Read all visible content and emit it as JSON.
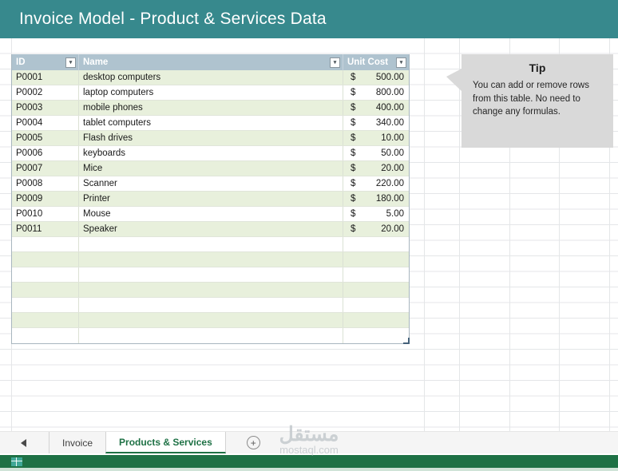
{
  "header": {
    "title": "Invoice Model - Product & Services Data"
  },
  "table": {
    "headers": [
      "ID",
      "Name",
      "Unit Cost"
    ],
    "rows": [
      {
        "id": "P0001",
        "name": "desktop computers",
        "cur": "$",
        "cost": "500.00"
      },
      {
        "id": "P0002",
        "name": "laptop computers",
        "cur": "$",
        "cost": "800.00"
      },
      {
        "id": "P0003",
        "name": "mobile phones",
        "cur": "$",
        "cost": "400.00"
      },
      {
        "id": "P0004",
        "name": "tablet computers",
        "cur": "$",
        "cost": "340.00"
      },
      {
        "id": "P0005",
        "name": "Flash drives",
        "cur": "$",
        "cost": "10.00"
      },
      {
        "id": "P0006",
        "name": "keyboards",
        "cur": "$",
        "cost": "50.00"
      },
      {
        "id": "P0007",
        "name": "Mice",
        "cur": "$",
        "cost": "20.00"
      },
      {
        "id": "P0008",
        "name": "Scanner",
        "cur": "$",
        "cost": "220.00"
      },
      {
        "id": "P0009",
        "name": "Printer",
        "cur": "$",
        "cost": "180.00"
      },
      {
        "id": "P0010",
        "name": "Mouse",
        "cur": "$",
        "cost": "5.00"
      },
      {
        "id": "P0011",
        "name": "Speaker",
        "cur": "$",
        "cost": "20.00"
      }
    ],
    "empty_rows": 7
  },
  "tip": {
    "title": "Tip",
    "body": "You can add or remove rows from this table. No need to change any formulas."
  },
  "tabs": {
    "items": [
      {
        "label": "Invoice",
        "active": false
      },
      {
        "label": "Products & Services",
        "active": true
      }
    ],
    "add_label": "+"
  },
  "watermark": {
    "name": "مستقل",
    "domain": "mostaql.com"
  },
  "icons": {
    "filter": "filter-dropdown-icon",
    "tab_scroll": "tab-scroll-left-icon",
    "status_grid": "sheet-grid-icon"
  },
  "colors": {
    "title_bar": "#37898D",
    "table_header": "#AFC3CF",
    "row_band_green": "#E8F0DC",
    "tip_background": "#D9D9D9",
    "active_tab_green": "#1E7145",
    "status_bar_green": "#1E7145"
  }
}
